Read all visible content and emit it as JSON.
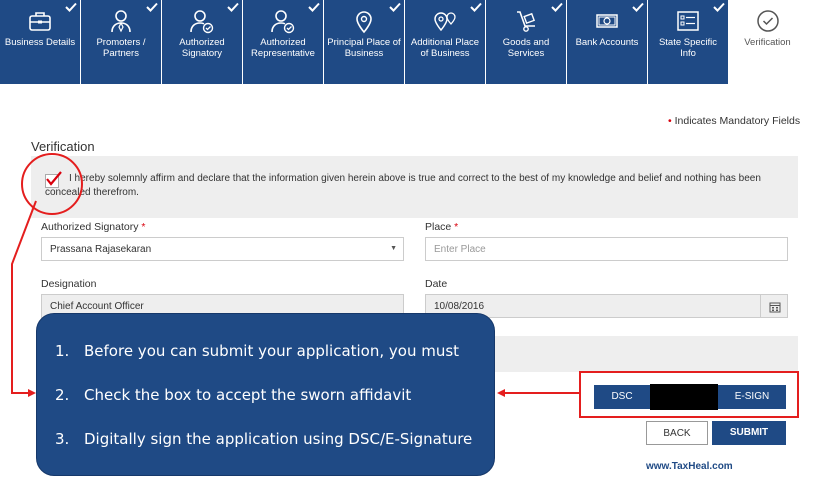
{
  "tabs": [
    {
      "label": "Business Details",
      "icon": "briefcase-icon",
      "completed": true
    },
    {
      "label": "Promoters / Partners",
      "icon": "person-icon",
      "completed": true
    },
    {
      "label": "Authorized Signatory",
      "icon": "person-check-icon",
      "completed": true
    },
    {
      "label": "Authorized Representative",
      "icon": "person-check-icon",
      "completed": true
    },
    {
      "label": "Principal Place of Business",
      "icon": "location-pin-icon",
      "completed": true
    },
    {
      "label": "Additional Place of Business",
      "icon": "multi-location-icon",
      "completed": true
    },
    {
      "label": "Goods and Services",
      "icon": "hand-truck-icon",
      "completed": true
    },
    {
      "label": "Bank Accounts",
      "icon": "bank-note-icon",
      "completed": true
    },
    {
      "label": "State Specific Info",
      "icon": "info-list-icon",
      "completed": true
    },
    {
      "label": "Verification",
      "icon": "circle-check-icon",
      "completed": false
    }
  ],
  "mandatory_note": "Indicates Mandatory Fields",
  "section_title": "Verification",
  "declaration": "I hereby solemnly affirm and declare that the information given herein above is true and correct to the best of my knowledge and belief and nothing has been concealed therefrom.",
  "form": {
    "authorized_signatory_label": "Authorized Signatory",
    "authorized_signatory_value": "Prassana Rajasekaran",
    "place_label": "Place",
    "place_placeholder": "Enter Place",
    "designation_label": "Designation",
    "designation_value": "Chief Account Officer",
    "date_label": "Date",
    "date_value": "10/08/2016"
  },
  "buttons": {
    "dsc": "DSC",
    "esign": "E-SIGN",
    "back": "BACK",
    "submit": "SUBMIT"
  },
  "callout": {
    "items": [
      {
        "num": "1.",
        "text": "Before you can submit  your application, you must"
      },
      {
        "num": "2.",
        "text": "Check the box to accept the sworn affidavit"
      },
      {
        "num": "3.",
        "text": "Digitally sign the application using DSC/E-Signature"
      }
    ]
  },
  "site": "www.TaxHeal.com",
  "colors": {
    "primary": "#1f4a85",
    "annotation": "#e41e1e",
    "required": "#d9000d"
  }
}
